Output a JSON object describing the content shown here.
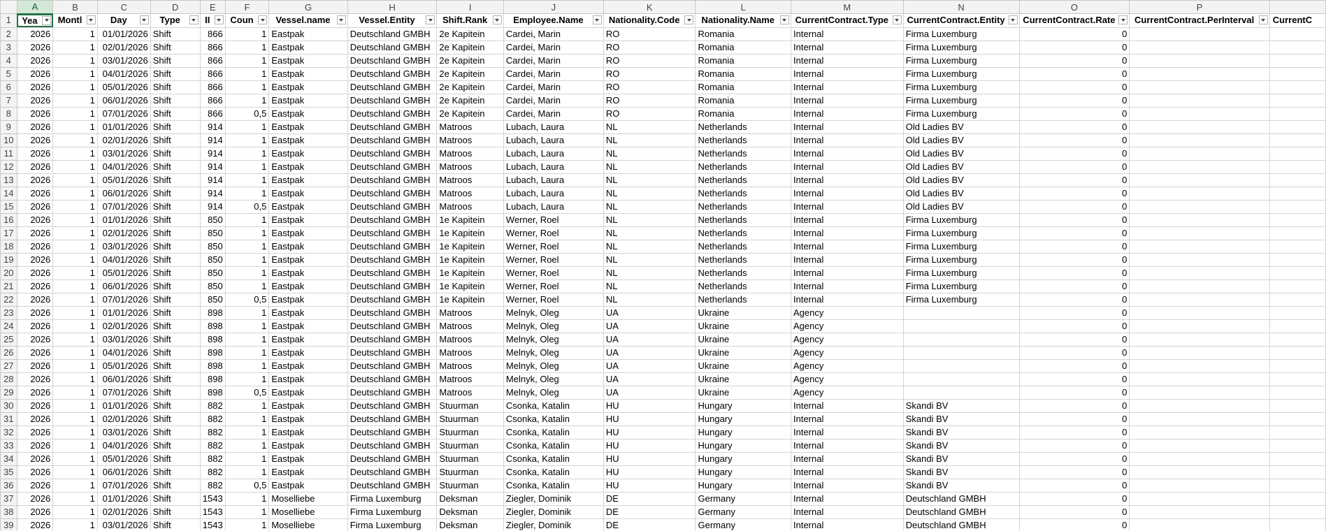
{
  "column_letters": [
    "A",
    "B",
    "C",
    "D",
    "E",
    "F",
    "G",
    "H",
    "I",
    "J",
    "K",
    "L",
    "M",
    "N",
    "O",
    "P",
    ""
  ],
  "selected_column": "A",
  "headers": [
    "Yea",
    "Montl",
    "Day",
    "Type",
    "II",
    "Coun",
    "Vessel.name",
    "Vessel.Entity",
    "Shift.Rank",
    "Employee.Name",
    "Nationality.Code",
    "Nationality.Name",
    "CurrentContract.Type",
    "CurrentContract.Entity",
    "CurrentContract.Rate",
    "CurrentContract.PerInterval",
    "CurrentC"
  ],
  "rows": [
    {
      "r": "2",
      "c": [
        "2026",
        "1",
        "01/01/2026",
        "Shift",
        "866",
        "1",
        "Eastpak",
        "Deutschland GMBH",
        "2e Kapitein",
        "Cardei, Marin",
        "RO",
        "Romania",
        "Internal",
        "Firma Luxemburg",
        "0",
        "",
        ""
      ]
    },
    {
      "r": "3",
      "c": [
        "2026",
        "1",
        "02/01/2026",
        "Shift",
        "866",
        "1",
        "Eastpak",
        "Deutschland GMBH",
        "2e Kapitein",
        "Cardei, Marin",
        "RO",
        "Romania",
        "Internal",
        "Firma Luxemburg",
        "0",
        "",
        ""
      ]
    },
    {
      "r": "4",
      "c": [
        "2026",
        "1",
        "03/01/2026",
        "Shift",
        "866",
        "1",
        "Eastpak",
        "Deutschland GMBH",
        "2e Kapitein",
        "Cardei, Marin",
        "RO",
        "Romania",
        "Internal",
        "Firma Luxemburg",
        "0",
        "",
        ""
      ]
    },
    {
      "r": "5",
      "c": [
        "2026",
        "1",
        "04/01/2026",
        "Shift",
        "866",
        "1",
        "Eastpak",
        "Deutschland GMBH",
        "2e Kapitein",
        "Cardei, Marin",
        "RO",
        "Romania",
        "Internal",
        "Firma Luxemburg",
        "0",
        "",
        ""
      ]
    },
    {
      "r": "6",
      "c": [
        "2026",
        "1",
        "05/01/2026",
        "Shift",
        "866",
        "1",
        "Eastpak",
        "Deutschland GMBH",
        "2e Kapitein",
        "Cardei, Marin",
        "RO",
        "Romania",
        "Internal",
        "Firma Luxemburg",
        "0",
        "",
        ""
      ]
    },
    {
      "r": "7",
      "c": [
        "2026",
        "1",
        "06/01/2026",
        "Shift",
        "866",
        "1",
        "Eastpak",
        "Deutschland GMBH",
        "2e Kapitein",
        "Cardei, Marin",
        "RO",
        "Romania",
        "Internal",
        "Firma Luxemburg",
        "0",
        "",
        ""
      ]
    },
    {
      "r": "8",
      "c": [
        "2026",
        "1",
        "07/01/2026",
        "Shift",
        "866",
        "0,5",
        "Eastpak",
        "Deutschland GMBH",
        "2e Kapitein",
        "Cardei, Marin",
        "RO",
        "Romania",
        "Internal",
        "Firma Luxemburg",
        "0",
        "",
        ""
      ]
    },
    {
      "r": "9",
      "c": [
        "2026",
        "1",
        "01/01/2026",
        "Shift",
        "914",
        "1",
        "Eastpak",
        "Deutschland GMBH",
        "Matroos",
        "Lubach, Laura",
        "NL",
        "Netherlands",
        "Internal",
        "Old Ladies BV",
        "0",
        "",
        ""
      ]
    },
    {
      "r": "10",
      "c": [
        "2026",
        "1",
        "02/01/2026",
        "Shift",
        "914",
        "1",
        "Eastpak",
        "Deutschland GMBH",
        "Matroos",
        "Lubach, Laura",
        "NL",
        "Netherlands",
        "Internal",
        "Old Ladies BV",
        "0",
        "",
        ""
      ]
    },
    {
      "r": "11",
      "c": [
        "2026",
        "1",
        "03/01/2026",
        "Shift",
        "914",
        "1",
        "Eastpak",
        "Deutschland GMBH",
        "Matroos",
        "Lubach, Laura",
        "NL",
        "Netherlands",
        "Internal",
        "Old Ladies BV",
        "0",
        "",
        ""
      ]
    },
    {
      "r": "12",
      "c": [
        "2026",
        "1",
        "04/01/2026",
        "Shift",
        "914",
        "1",
        "Eastpak",
        "Deutschland GMBH",
        "Matroos",
        "Lubach, Laura",
        "NL",
        "Netherlands",
        "Internal",
        "Old Ladies BV",
        "0",
        "",
        ""
      ]
    },
    {
      "r": "13",
      "c": [
        "2026",
        "1",
        "05/01/2026",
        "Shift",
        "914",
        "1",
        "Eastpak",
        "Deutschland GMBH",
        "Matroos",
        "Lubach, Laura",
        "NL",
        "Netherlands",
        "Internal",
        "Old Ladies BV",
        "0",
        "",
        ""
      ]
    },
    {
      "r": "14",
      "c": [
        "2026",
        "1",
        "06/01/2026",
        "Shift",
        "914",
        "1",
        "Eastpak",
        "Deutschland GMBH",
        "Matroos",
        "Lubach, Laura",
        "NL",
        "Netherlands",
        "Internal",
        "Old Ladies BV",
        "0",
        "",
        ""
      ]
    },
    {
      "r": "15",
      "c": [
        "2026",
        "1",
        "07/01/2026",
        "Shift",
        "914",
        "0,5",
        "Eastpak",
        "Deutschland GMBH",
        "Matroos",
        "Lubach, Laura",
        "NL",
        "Netherlands",
        "Internal",
        "Old Ladies BV",
        "0",
        "",
        ""
      ]
    },
    {
      "r": "16",
      "c": [
        "2026",
        "1",
        "01/01/2026",
        "Shift",
        "850",
        "1",
        "Eastpak",
        "Deutschland GMBH",
        "1e Kapitein",
        "Werner, Roel",
        "NL",
        "Netherlands",
        "Internal",
        "Firma Luxemburg",
        "0",
        "",
        ""
      ]
    },
    {
      "r": "17",
      "c": [
        "2026",
        "1",
        "02/01/2026",
        "Shift",
        "850",
        "1",
        "Eastpak",
        "Deutschland GMBH",
        "1e Kapitein",
        "Werner, Roel",
        "NL",
        "Netherlands",
        "Internal",
        "Firma Luxemburg",
        "0",
        "",
        ""
      ]
    },
    {
      "r": "18",
      "c": [
        "2026",
        "1",
        "03/01/2026",
        "Shift",
        "850",
        "1",
        "Eastpak",
        "Deutschland GMBH",
        "1e Kapitein",
        "Werner, Roel",
        "NL",
        "Netherlands",
        "Internal",
        "Firma Luxemburg",
        "0",
        "",
        ""
      ]
    },
    {
      "r": "19",
      "c": [
        "2026",
        "1",
        "04/01/2026",
        "Shift",
        "850",
        "1",
        "Eastpak",
        "Deutschland GMBH",
        "1e Kapitein",
        "Werner, Roel",
        "NL",
        "Netherlands",
        "Internal",
        "Firma Luxemburg",
        "0",
        "",
        ""
      ]
    },
    {
      "r": "20",
      "c": [
        "2026",
        "1",
        "05/01/2026",
        "Shift",
        "850",
        "1",
        "Eastpak",
        "Deutschland GMBH",
        "1e Kapitein",
        "Werner, Roel",
        "NL",
        "Netherlands",
        "Internal",
        "Firma Luxemburg",
        "0",
        "",
        ""
      ]
    },
    {
      "r": "21",
      "c": [
        "2026",
        "1",
        "06/01/2026",
        "Shift",
        "850",
        "1",
        "Eastpak",
        "Deutschland GMBH",
        "1e Kapitein",
        "Werner, Roel",
        "NL",
        "Netherlands",
        "Internal",
        "Firma Luxemburg",
        "0",
        "",
        ""
      ]
    },
    {
      "r": "22",
      "c": [
        "2026",
        "1",
        "07/01/2026",
        "Shift",
        "850",
        "0,5",
        "Eastpak",
        "Deutschland GMBH",
        "1e Kapitein",
        "Werner, Roel",
        "NL",
        "Netherlands",
        "Internal",
        "Firma Luxemburg",
        "0",
        "",
        ""
      ]
    },
    {
      "r": "23",
      "c": [
        "2026",
        "1",
        "01/01/2026",
        "Shift",
        "898",
        "1",
        "Eastpak",
        "Deutschland GMBH",
        "Matroos",
        "Melnyk, Oleg",
        "UA",
        "Ukraine",
        "Agency",
        "",
        "0",
        "",
        ""
      ]
    },
    {
      "r": "24",
      "c": [
        "2026",
        "1",
        "02/01/2026",
        "Shift",
        "898",
        "1",
        "Eastpak",
        "Deutschland GMBH",
        "Matroos",
        "Melnyk, Oleg",
        "UA",
        "Ukraine",
        "Agency",
        "",
        "0",
        "",
        ""
      ]
    },
    {
      "r": "25",
      "c": [
        "2026",
        "1",
        "03/01/2026",
        "Shift",
        "898",
        "1",
        "Eastpak",
        "Deutschland GMBH",
        "Matroos",
        "Melnyk, Oleg",
        "UA",
        "Ukraine",
        "Agency",
        "",
        "0",
        "",
        ""
      ]
    },
    {
      "r": "26",
      "c": [
        "2026",
        "1",
        "04/01/2026",
        "Shift",
        "898",
        "1",
        "Eastpak",
        "Deutschland GMBH",
        "Matroos",
        "Melnyk, Oleg",
        "UA",
        "Ukraine",
        "Agency",
        "",
        "0",
        "",
        ""
      ]
    },
    {
      "r": "27",
      "c": [
        "2026",
        "1",
        "05/01/2026",
        "Shift",
        "898",
        "1",
        "Eastpak",
        "Deutschland GMBH",
        "Matroos",
        "Melnyk, Oleg",
        "UA",
        "Ukraine",
        "Agency",
        "",
        "0",
        "",
        ""
      ]
    },
    {
      "r": "28",
      "c": [
        "2026",
        "1",
        "06/01/2026",
        "Shift",
        "898",
        "1",
        "Eastpak",
        "Deutschland GMBH",
        "Matroos",
        "Melnyk, Oleg",
        "UA",
        "Ukraine",
        "Agency",
        "",
        "0",
        "",
        ""
      ]
    },
    {
      "r": "29",
      "c": [
        "2026",
        "1",
        "07/01/2026",
        "Shift",
        "898",
        "0,5",
        "Eastpak",
        "Deutschland GMBH",
        "Matroos",
        "Melnyk, Oleg",
        "UA",
        "Ukraine",
        "Agency",
        "",
        "0",
        "",
        ""
      ]
    },
    {
      "r": "30",
      "c": [
        "2026",
        "1",
        "01/01/2026",
        "Shift",
        "882",
        "1",
        "Eastpak",
        "Deutschland GMBH",
        "Stuurman",
        "Csonka, Katalin",
        "HU",
        "Hungary",
        "Internal",
        "Skandi BV",
        "0",
        "",
        ""
      ]
    },
    {
      "r": "31",
      "c": [
        "2026",
        "1",
        "02/01/2026",
        "Shift",
        "882",
        "1",
        "Eastpak",
        "Deutschland GMBH",
        "Stuurman",
        "Csonka, Katalin",
        "HU",
        "Hungary",
        "Internal",
        "Skandi BV",
        "0",
        "",
        ""
      ]
    },
    {
      "r": "32",
      "c": [
        "2026",
        "1",
        "03/01/2026",
        "Shift",
        "882",
        "1",
        "Eastpak",
        "Deutschland GMBH",
        "Stuurman",
        "Csonka, Katalin",
        "HU",
        "Hungary",
        "Internal",
        "Skandi BV",
        "0",
        "",
        ""
      ]
    },
    {
      "r": "33",
      "c": [
        "2026",
        "1",
        "04/01/2026",
        "Shift",
        "882",
        "1",
        "Eastpak",
        "Deutschland GMBH",
        "Stuurman",
        "Csonka, Katalin",
        "HU",
        "Hungary",
        "Internal",
        "Skandi BV",
        "0",
        "",
        ""
      ]
    },
    {
      "r": "34",
      "c": [
        "2026",
        "1",
        "05/01/2026",
        "Shift",
        "882",
        "1",
        "Eastpak",
        "Deutschland GMBH",
        "Stuurman",
        "Csonka, Katalin",
        "HU",
        "Hungary",
        "Internal",
        "Skandi BV",
        "0",
        "",
        ""
      ]
    },
    {
      "r": "35",
      "c": [
        "2026",
        "1",
        "06/01/2026",
        "Shift",
        "882",
        "1",
        "Eastpak",
        "Deutschland GMBH",
        "Stuurman",
        "Csonka, Katalin",
        "HU",
        "Hungary",
        "Internal",
        "Skandi BV",
        "0",
        "",
        ""
      ]
    },
    {
      "r": "36",
      "c": [
        "2026",
        "1",
        "07/01/2026",
        "Shift",
        "882",
        "0,5",
        "Eastpak",
        "Deutschland GMBH",
        "Stuurman",
        "Csonka, Katalin",
        "HU",
        "Hungary",
        "Internal",
        "Skandi BV",
        "0",
        "",
        ""
      ]
    },
    {
      "r": "37",
      "c": [
        "2026",
        "1",
        "01/01/2026",
        "Shift",
        "1543",
        "1",
        "Moselliebe",
        "Firma Luxemburg",
        "Deksman",
        "Ziegler, Dominik",
        "DE",
        "Germany",
        "Internal",
        "Deutschland GMBH",
        "0",
        "",
        ""
      ]
    },
    {
      "r": "38",
      "c": [
        "2026",
        "1",
        "02/01/2026",
        "Shift",
        "1543",
        "1",
        "Moselliebe",
        "Firma Luxemburg",
        "Deksman",
        "Ziegler, Dominik",
        "DE",
        "Germany",
        "Internal",
        "Deutschland GMBH",
        "0",
        "",
        ""
      ]
    },
    {
      "r": "39",
      "c": [
        "2026",
        "1",
        "03/01/2026",
        "Shift",
        "1543",
        "1",
        "Moselliebe",
        "Firma Luxemburg",
        "Deksman",
        "Ziegler, Dominik",
        "DE",
        "Germany",
        "Internal",
        "Deutschland GMBH",
        "0",
        "",
        ""
      ]
    }
  ]
}
